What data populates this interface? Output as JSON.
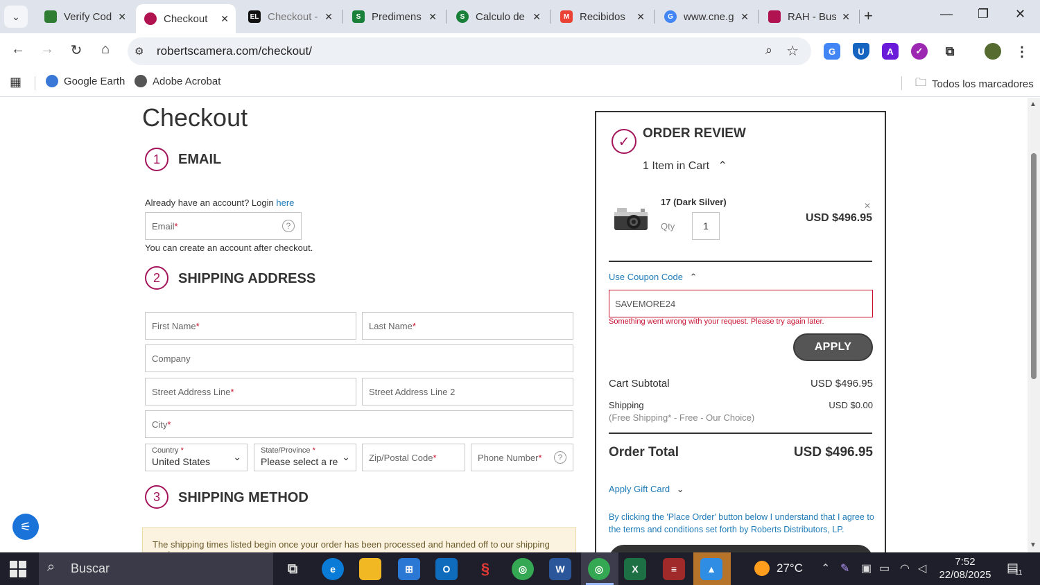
{
  "browser": {
    "tabs": [
      {
        "label": "Verify Code",
        "favicon_color": "#2e7d32",
        "active": false
      },
      {
        "label": "Checkout",
        "favicon_color": "#b0134f",
        "active": true
      },
      {
        "label": "Checkout - ",
        "favicon_color": "#111111",
        "active": false
      },
      {
        "label": "Predimens",
        "favicon_color": "#188038",
        "active": false
      },
      {
        "label": "Calculo de",
        "favicon_color": "#188038",
        "active": false
      },
      {
        "label": "Recibidos",
        "favicon_color": "#ea4335",
        "active": false
      },
      {
        "label": "www.cne.g",
        "favicon_color": "#4285f4",
        "active": false
      },
      {
        "label": "RAH - Busc",
        "favicon_color": "#b0134f",
        "active": false
      }
    ],
    "url": "robertscamera.com/checkout/",
    "bookmarks": [
      {
        "label": "Google Earth",
        "icon_color": "#3a78d8"
      },
      {
        "label": "Adobe Acrobat",
        "icon_color": "#555555"
      }
    ],
    "all_bookmarks_label": "Todos los marcadores"
  },
  "checkout": {
    "title": "Checkout",
    "steps": {
      "email": {
        "number": "1",
        "title": "EMAIL"
      },
      "shipping_address": {
        "number": "2",
        "title": "SHIPPING ADDRESS"
      },
      "shipping_method": {
        "number": "3",
        "title": "SHIPPING METHOD"
      }
    },
    "account_prompt": "Already have an account? Login ",
    "account_link": "here",
    "email_placeholder": "Email",
    "create_account_note": "You can create an account after checkout.",
    "fields": {
      "first_name": "First Name",
      "last_name": "Last Name",
      "company": "Company",
      "street1": "Street Address Line",
      "street2": "Street Address Line 2",
      "city": "City",
      "country_label": "Country",
      "country_value": "United States",
      "state_label": "State/Province",
      "state_value": "Please select a regi",
      "zip": "Zip/Postal Code",
      "phone": "Phone Number"
    },
    "required_mark": "*",
    "shipping_notice": "The shipping times listed begin once your order has been processed and handed off to our shipping carrier."
  },
  "order_review": {
    "title": "ORDER REVIEW",
    "cart_count_label": "1 Item in Cart",
    "product": {
      "name": "17 (Dark Silver)",
      "qty_label": "Qty",
      "qty": "1",
      "price": "USD $496.95"
    },
    "coupon_toggle": "Use Coupon Code",
    "coupon_value": "SAVEMORE24",
    "coupon_error": "Something went wrong with your request. Please try again later.",
    "apply_label": "APPLY",
    "subtotal_label": "Cart Subtotal",
    "subtotal_value": "USD $496.95",
    "shipping_label": "Shipping",
    "shipping_detail": "(Free Shipping* - Free - Our Choice)",
    "shipping_value": "USD $0.00",
    "total_label": "Order Total",
    "total_value": "USD $496.95",
    "gift_card_label": "Apply Gift Card",
    "terms_text": "By clicking the 'Place Order' button below I understand that I agree to the terms and conditions set forth by Roberts Distributors, LP."
  },
  "taskbar": {
    "search_label": "Buscar",
    "temperature": "27°C",
    "time": "7:52",
    "date": "22/08/2025",
    "notification_count": "11"
  }
}
